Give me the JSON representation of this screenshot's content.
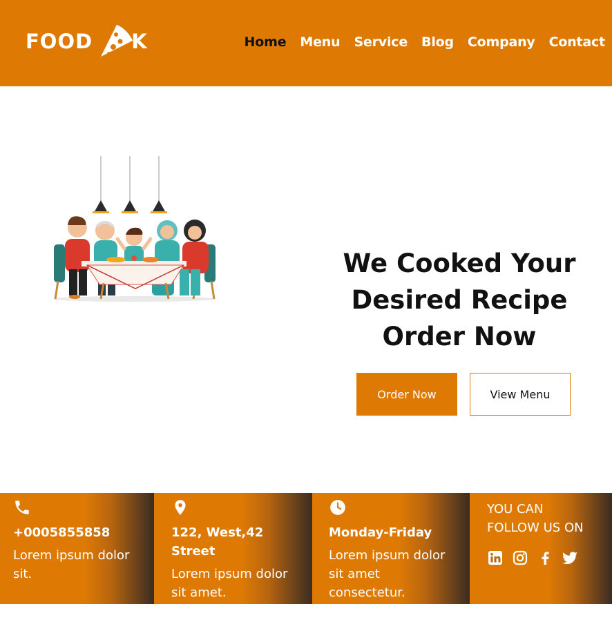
{
  "brand": {
    "logo_prefix": "FOOD",
    "logo_suffix": "K"
  },
  "nav": {
    "items": [
      {
        "label": "Home",
        "active": true
      },
      {
        "label": "Menu",
        "active": false
      },
      {
        "label": "Service",
        "active": false
      },
      {
        "label": "Blog",
        "active": false
      },
      {
        "label": "Company",
        "active": false
      },
      {
        "label": "Contact",
        "active": false
      }
    ]
  },
  "hero": {
    "title_line1": "We Cooked Your",
    "title_line2": "Desired Recipe",
    "title_line3": "Order Now",
    "order_button": "Order Now",
    "menu_button": "View Menu"
  },
  "info": {
    "phone": {
      "icon": "phone-icon",
      "heading": "+0005855858",
      "text": "Lorem ipsum dolor sit."
    },
    "address": {
      "icon": "map-pin-icon",
      "heading": "122, West,42 Street",
      "text": "Lorem ipsum dolor sit amet."
    },
    "hours": {
      "icon": "clock-icon",
      "heading": "Monday-Friday",
      "text": "Lorem ipsum dolor sit amet consectetur."
    },
    "follow": {
      "title": "YOU CAN FOLLOW US ON",
      "socials": [
        "linkedin-icon",
        "instagram-icon",
        "facebook-icon",
        "twitter-icon"
      ]
    }
  },
  "colors": {
    "accent": "#de7a04",
    "text": "#111111",
    "white": "#ffffff"
  }
}
